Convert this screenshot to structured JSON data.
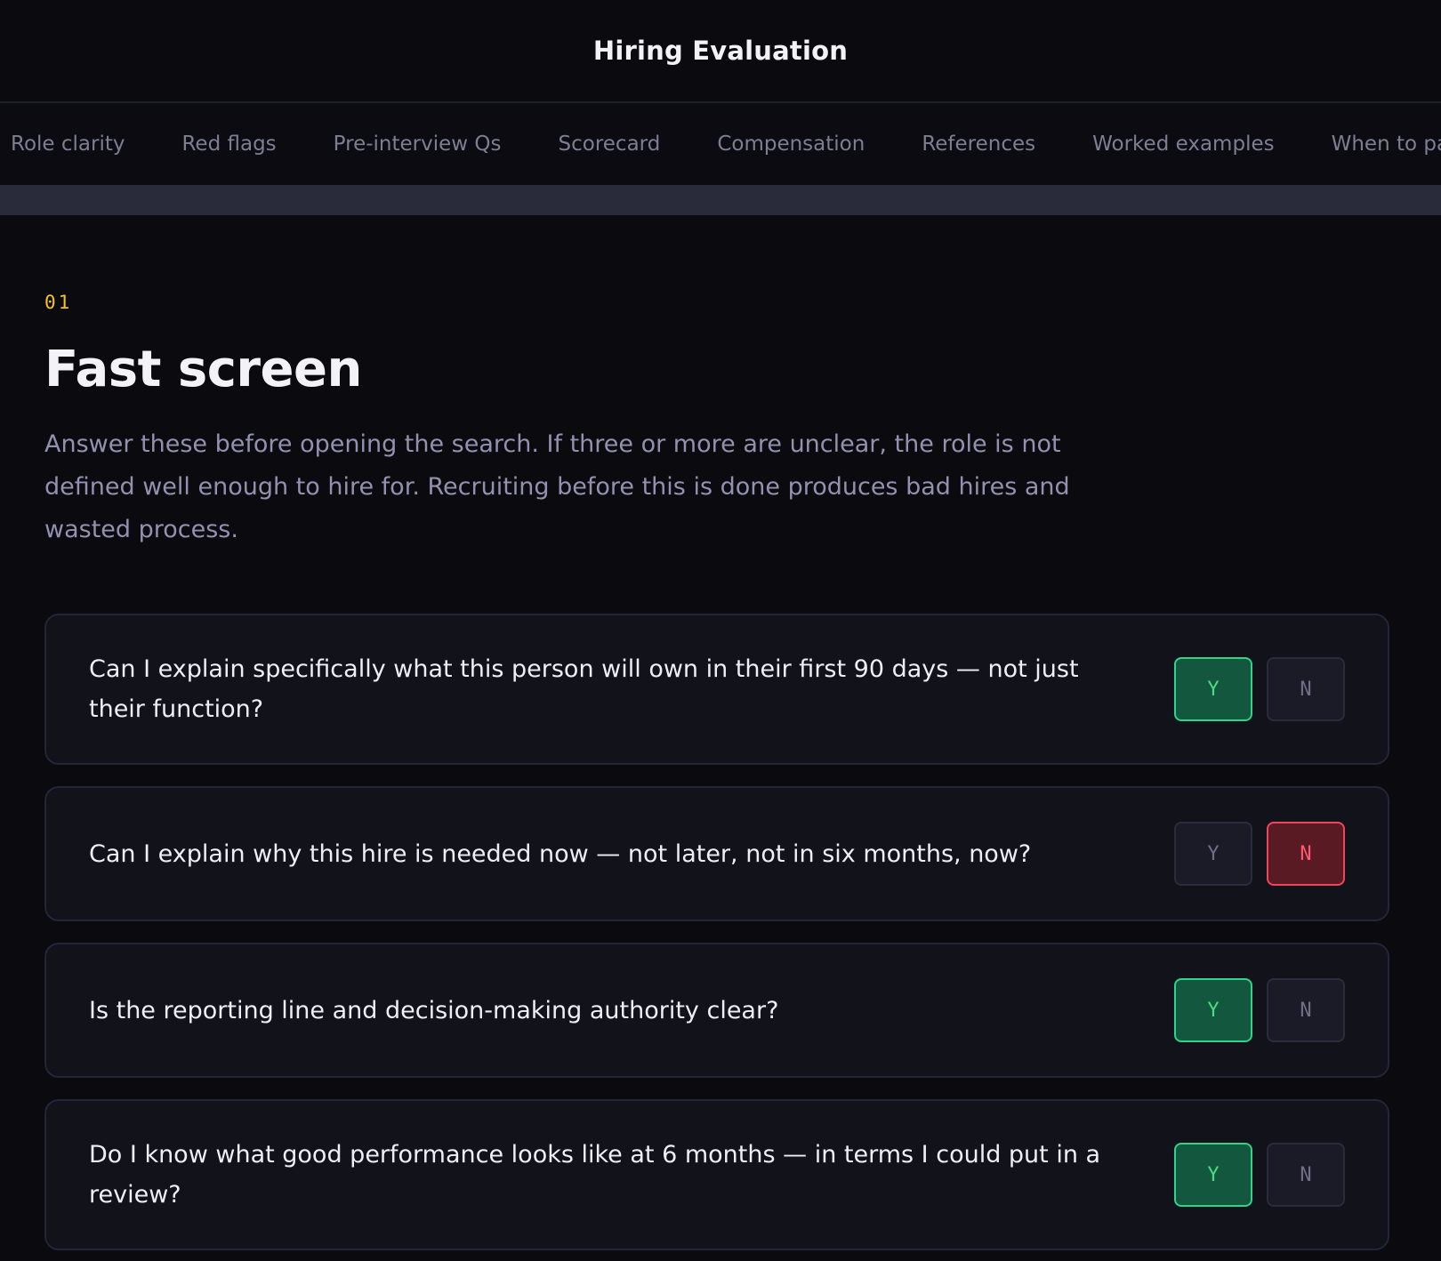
{
  "header": {
    "title": "Hiring Evaluation"
  },
  "tabs": [
    {
      "label": "Role clarity"
    },
    {
      "label": "Red flags"
    },
    {
      "label": "Pre-interview Qs"
    },
    {
      "label": "Scorecard"
    },
    {
      "label": "Compensation"
    },
    {
      "label": "References"
    },
    {
      "label": "Worked examples"
    },
    {
      "label": "When to pa"
    }
  ],
  "section": {
    "number": "01",
    "title": "Fast screen",
    "description": "Answer these before opening the search. If three or more are unclear, the role is not defined well enough to hire for. Recruiting before this is done produces bad hires and wasted process."
  },
  "questions": [
    {
      "text": "Can I explain specifically what this person will own in their first 90 days — not just their function?",
      "yes_label": "Y",
      "no_label": "N",
      "answer": "Y"
    },
    {
      "text": "Can I explain why this hire is needed now — not later, not in six months, now?",
      "yes_label": "Y",
      "no_label": "N",
      "answer": "N"
    },
    {
      "text": "Is the reporting line and decision-making authority clear?",
      "yes_label": "Y",
      "no_label": "N",
      "answer": "Y"
    },
    {
      "text": "Do I know what good performance looks like at 6 months — in terms I could put in a review?",
      "yes_label": "Y",
      "no_label": "N",
      "answer": "Y"
    }
  ],
  "colors": {
    "background": "#0a0a0f",
    "accent_number": "#f5c518",
    "yes_active": "#2dd48a",
    "no_active": "#f0465a"
  }
}
